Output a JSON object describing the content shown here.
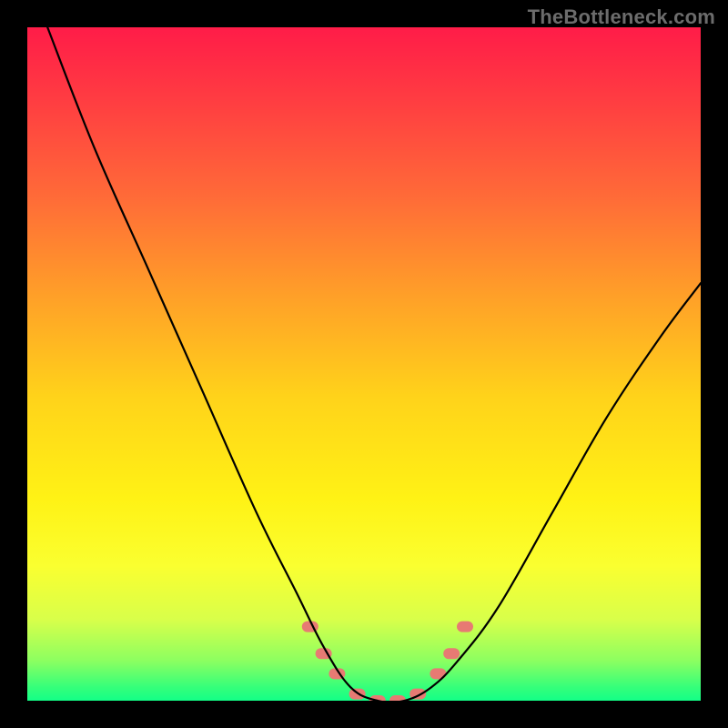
{
  "watermark": {
    "text": "TheBottleneck.com"
  },
  "chart_data": {
    "type": "line",
    "title": "",
    "xlabel": "",
    "ylabel": "",
    "xlim": [
      0,
      100
    ],
    "ylim": [
      0,
      100
    ],
    "gradient_axis": "y",
    "gradient_stops": [
      {
        "pos": 0,
        "color": "#ff1c48"
      },
      {
        "pos": 25,
        "color": "#ff6a38"
      },
      {
        "pos": 55,
        "color": "#ffd31a"
      },
      {
        "pos": 80,
        "color": "#faff30"
      },
      {
        "pos": 94,
        "color": "#8dff60"
      },
      {
        "pos": 100,
        "color": "#13ff87"
      }
    ],
    "series": [
      {
        "name": "bottleneck-curve",
        "x": [
          3,
          10,
          18,
          26,
          34,
          40,
          44,
          48,
          52,
          56,
          60,
          64,
          70,
          78,
          86,
          94,
          100
        ],
        "y": [
          100,
          82,
          64,
          46,
          28,
          16,
          8,
          2,
          0,
          0,
          2,
          6,
          14,
          28,
          42,
          54,
          62
        ]
      }
    ],
    "markers": {
      "name": "highlight-dots",
      "color": "#e77a73",
      "points": [
        {
          "x": 42,
          "y": 11
        },
        {
          "x": 44,
          "y": 7
        },
        {
          "x": 46,
          "y": 4
        },
        {
          "x": 49,
          "y": 1
        },
        {
          "x": 52,
          "y": 0
        },
        {
          "x": 55,
          "y": 0
        },
        {
          "x": 58,
          "y": 1
        },
        {
          "x": 61,
          "y": 4
        },
        {
          "x": 63,
          "y": 7
        },
        {
          "x": 65,
          "y": 11
        }
      ]
    }
  }
}
